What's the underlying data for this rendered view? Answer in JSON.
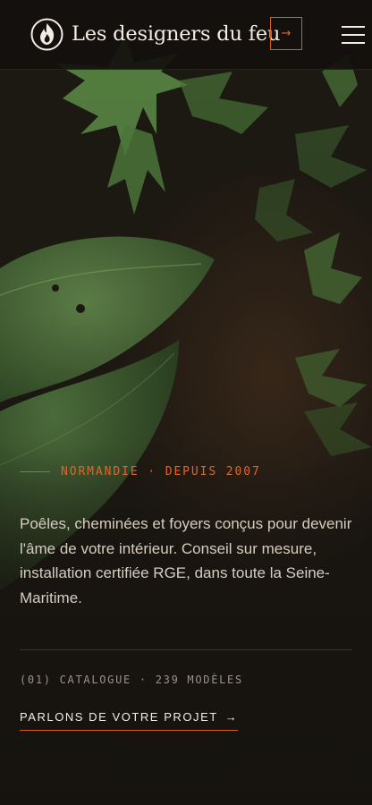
{
  "header": {
    "brand": "Les designers du feu",
    "logo_icon": "flame-icon",
    "cta_icon": "arrow-right-icon",
    "menu_icon": "hamburger-menu-icon"
  },
  "hero": {
    "eyebrow": "NORMANDIE · DEPUIS 2007",
    "description": "Poêles, cheminées et foyers conçus pour devenir l'âme de votre intérieur. Conseil sur mesure, installation certifiée RGE, dans toute la Seine-Maritime.",
    "catalog": "(01) CATALOGUE · 239 MODÈLES",
    "cta_label": "PARLONS DE VOTRE PROJET",
    "cta_arrow": "→"
  },
  "colors": {
    "accent": "#d85a24",
    "background": "#16130f",
    "text": "#f3ece2",
    "foliage": "#4e7a3e"
  }
}
